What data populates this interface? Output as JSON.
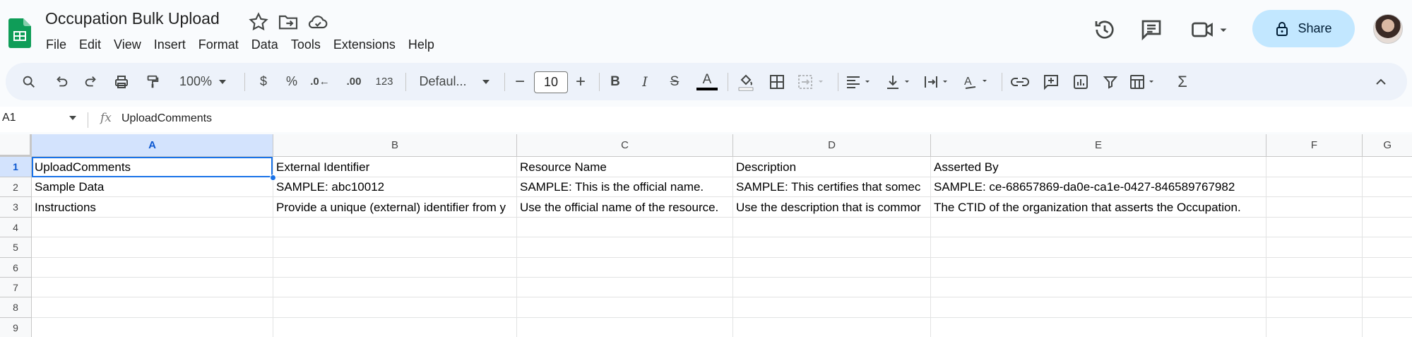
{
  "app": {
    "doc_title": "Occupation Bulk Upload",
    "menu": [
      "File",
      "Edit",
      "View",
      "Insert",
      "Format",
      "Data",
      "Tools",
      "Extensions",
      "Help"
    ],
    "share_label": "Share",
    "accent_color": "#1a73e8",
    "share_bg": "#c2e7ff"
  },
  "toolbar": {
    "zoom": "100%",
    "currency": "$",
    "percent": "%",
    "dec_decrease": ".0←",
    "dec_increase": ".00",
    "number_format": "123",
    "font_family": "Defaul...",
    "font_size": "10",
    "bold": "B",
    "italic": "I",
    "strike": "S",
    "text_color": "A",
    "icons": [
      "search-icon",
      "undo-icon",
      "redo-icon",
      "print-icon",
      "paint-format-icon",
      "fill-color-icon",
      "borders-icon",
      "merge-cells-icon",
      "align-icon",
      "vertical-align-icon",
      "text-wrap-icon",
      "text-rotation-icon",
      "link-icon",
      "comment-icon",
      "chart-icon",
      "filter-icon",
      "filter-views-icon",
      "functions-icon",
      "collapse-icon"
    ]
  },
  "formula_bar": {
    "name_box": "A1",
    "fx": "fx",
    "value": "UploadComments"
  },
  "sheet": {
    "columns": [
      "A",
      "B",
      "C",
      "D",
      "E",
      "F",
      "G"
    ],
    "rows": [
      "1",
      "2",
      "3",
      "4",
      "5",
      "6",
      "7",
      "8",
      "9"
    ],
    "cells": [
      [
        "UploadComments",
        "External Identifier",
        "Resource Name",
        "Description",
        "Asserted By"
      ],
      [
        "Sample Data",
        "SAMPLE: abc10012",
        "SAMPLE: This is the official name.",
        "SAMPLE: This certifies that somec",
        "SAMPLE: ce-68657869-da0e-ca1e-0427-846589767982"
      ],
      [
        "Instructions",
        "Provide a unique (external) identifier from y",
        "Use the official name of the resource.",
        "Use the description that is commor",
        "The CTID of the organization that asserts the Occupation."
      ]
    ]
  }
}
